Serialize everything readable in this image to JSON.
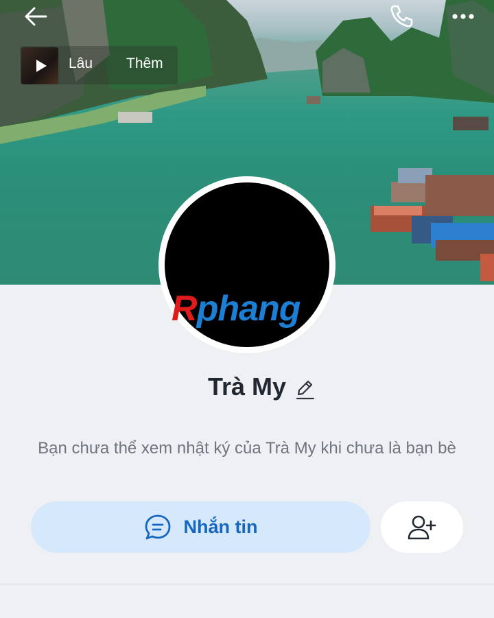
{
  "header": {
    "back_icon": "arrow-left-icon",
    "call_icon": "phone-icon",
    "more_icon": "more-dots-icon"
  },
  "music": {
    "title": "Lâu",
    "more_label": "Thêm",
    "play_icon": "play-icon"
  },
  "profile": {
    "avatar_watermark_first": "R",
    "avatar_watermark_rest": "phang",
    "name": "Trà My",
    "edit_icon": "pencil-icon",
    "notice": "Bạn chưa thể xem nhật ký của Trà My khi chưa là bạn bè"
  },
  "actions": {
    "message_label": "Nhắn tin",
    "message_icon": "chat-bubble-icon",
    "add_friend_icon": "add-user-icon"
  },
  "colors": {
    "accent": "#1566c0",
    "message_button_bg": "#d6e8fb",
    "page_bg": "#eef0f3"
  }
}
